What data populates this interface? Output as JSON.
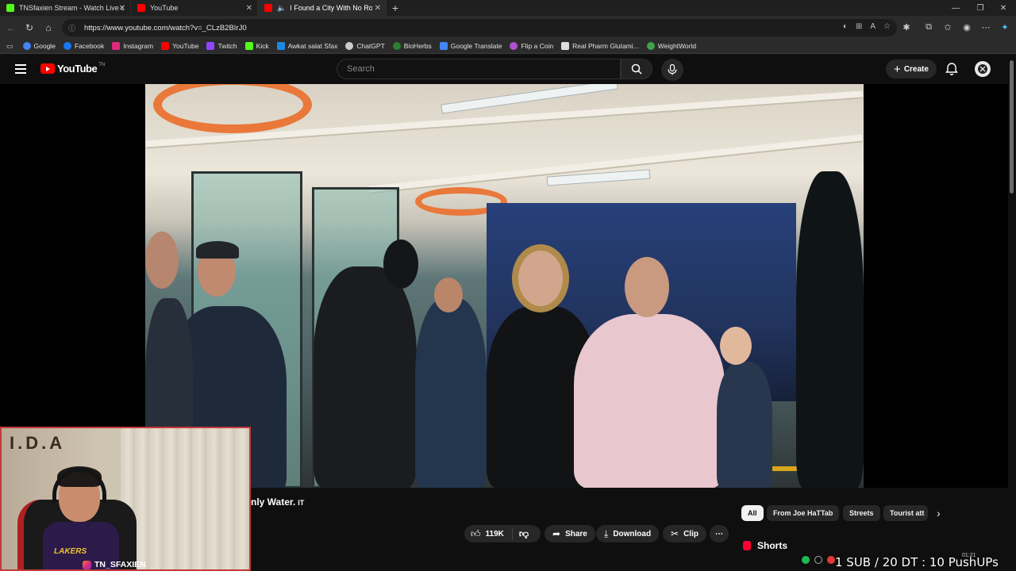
{
  "browser": {
    "tabs": [
      {
        "label": "TNSfaxien Stream - Watch Live on",
        "favicon_color": "#53fc18",
        "active": false
      },
      {
        "label": "YouTube",
        "favicon_color": "#ff0000",
        "active": false
      },
      {
        "label": "I Found a City With No Road",
        "favicon_color": "#ff0000",
        "active": true
      }
    ],
    "url": "https://www.youtube.com/watch?v=_CLzB2BIrJ0",
    "bookmarks": [
      {
        "label": "Google",
        "color": "#4285f4"
      },
      {
        "label": "Facebook",
        "color": "#1877f2"
      },
      {
        "label": "Instagram",
        "color": "#dd2a7b"
      },
      {
        "label": "YouTube",
        "color": "#ff0000"
      },
      {
        "label": "Twitch",
        "color": "#9146ff"
      },
      {
        "label": "Kick",
        "color": "#53fc18"
      },
      {
        "label": "Awkat salat Sfax",
        "color": "#1e88e5"
      },
      {
        "label": "ChatGPT",
        "color": "#cccccc"
      },
      {
        "label": "BioHerbs",
        "color": "#2e7d32"
      },
      {
        "label": "Google Translate",
        "color": "#4285f4"
      },
      {
        "label": "Flip a Coin",
        "color": "#b04fd0"
      },
      {
        "label": "Real Pharm Glutami...",
        "color": "#dddddd"
      },
      {
        "label": "WeightWorld",
        "color": "#3fa34d"
      }
    ]
  },
  "youtube": {
    "logo_text": "YouTube",
    "country_code": "TN",
    "search_placeholder": "Search",
    "create_label": "Create",
    "video_title": "nly Water.",
    "title_suffix": "IT",
    "actions": {
      "like_count": "119K",
      "share_label": "Share",
      "download_label": "Download",
      "clip_label": "Clip"
    },
    "chips": [
      "All",
      "From Joe HaTTab",
      "Streets",
      "Tourist att"
    ],
    "shorts_label": "Shorts"
  },
  "stream_overlay": {
    "handle": "TN_SFAXIEN",
    "goal_text": "1 SUB / 20 DT : 10 PushUPs",
    "clock": "01:21"
  },
  "colors": {
    "accent_red": "#ff0000",
    "page_bg": "#0f0f0f",
    "chip_bg": "#272727"
  }
}
